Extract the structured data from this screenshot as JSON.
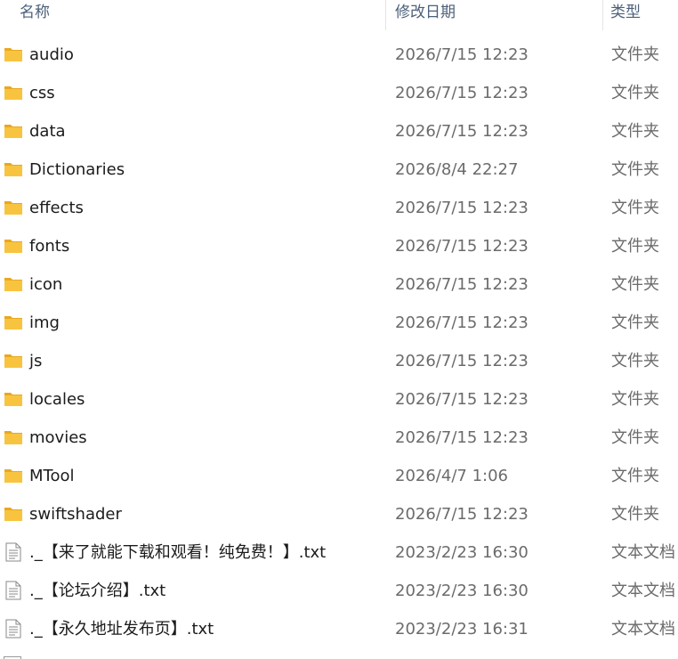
{
  "header": {
    "name": "名称",
    "date": "修改日期",
    "type": "类型"
  },
  "files": [
    {
      "name": "audio",
      "date": "2026/7/15 12:23",
      "type": "文件夹",
      "icon": "folder-icon"
    },
    {
      "name": "css",
      "date": "2026/7/15 12:23",
      "type": "文件夹",
      "icon": "folder-icon"
    },
    {
      "name": "data",
      "date": "2026/7/15 12:23",
      "type": "文件夹",
      "icon": "folder-icon"
    },
    {
      "name": "Dictionaries",
      "date": "2026/8/4 22:27",
      "type": "文件夹",
      "icon": "folder-icon"
    },
    {
      "name": "effects",
      "date": "2026/7/15 12:23",
      "type": "文件夹",
      "icon": "folder-icon"
    },
    {
      "name": "fonts",
      "date": "2026/7/15 12:23",
      "type": "文件夹",
      "icon": "folder-icon"
    },
    {
      "name": "icon",
      "date": "2026/7/15 12:23",
      "type": "文件夹",
      "icon": "folder-icon"
    },
    {
      "name": "img",
      "date": "2026/7/15 12:23",
      "type": "文件夹",
      "icon": "folder-icon"
    },
    {
      "name": "js",
      "date": "2026/7/15 12:23",
      "type": "文件夹",
      "icon": "folder-icon"
    },
    {
      "name": "locales",
      "date": "2026/7/15 12:23",
      "type": "文件夹",
      "icon": "folder-icon"
    },
    {
      "name": "movies",
      "date": "2026/7/15 12:23",
      "type": "文件夹",
      "icon": "folder-icon"
    },
    {
      "name": "MTool",
      "date": "2026/4/7 1:06",
      "type": "文件夹",
      "icon": "folder-icon"
    },
    {
      "name": "swiftshader",
      "date": "2026/7/15 12:23",
      "type": "文件夹",
      "icon": "folder-icon"
    },
    {
      "name": "._【来了就能下载和观看！纯免费！】.txt",
      "date": "2023/2/23 16:30",
      "type": "文本文档",
      "icon": "text-file-icon"
    },
    {
      "name": "._【论坛介绍】.txt",
      "date": "2023/2/23 16:30",
      "type": "文本文档",
      "icon": "text-file-icon"
    },
    {
      "name": "._【永久地址发布页】.txt",
      "date": "2023/2/23 16:31",
      "type": "文本文档",
      "icon": "text-file-icon"
    }
  ],
  "colors": {
    "folder": "#f8c440",
    "folder_dark": "#e9a820",
    "header_text": "#4c607a"
  }
}
